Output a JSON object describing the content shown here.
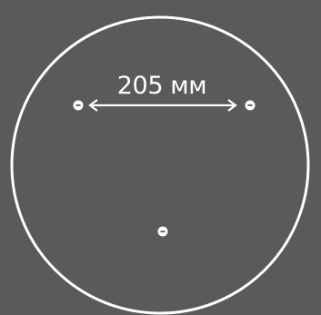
{
  "dimension_label": "205 мм",
  "colors": {
    "background": "#5b5a58",
    "line": "#ffffff"
  }
}
